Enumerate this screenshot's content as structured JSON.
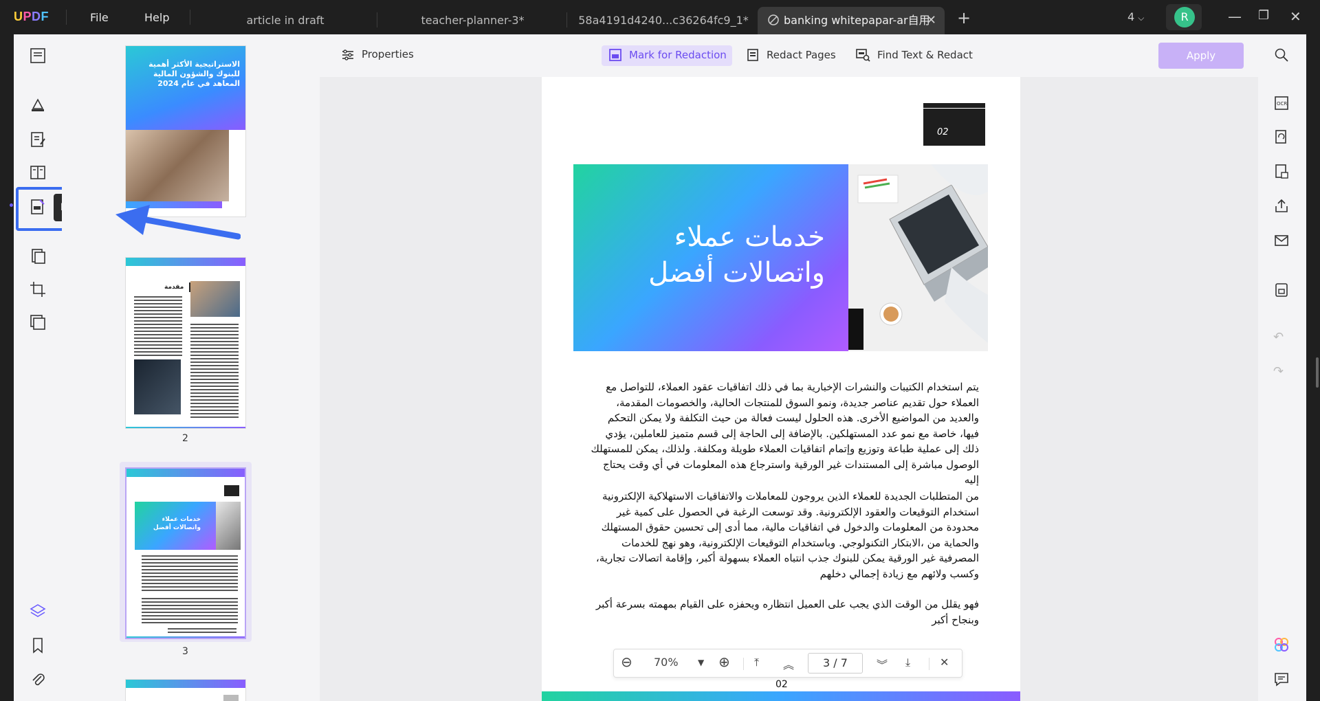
{
  "app": {
    "logo": "UPDF",
    "menu": [
      "File",
      "Help"
    ]
  },
  "tabs": [
    {
      "label": "article in draft"
    },
    {
      "label": "teacher-planner-3*"
    },
    {
      "label": "58a4191d4240...c36264fc9_1*"
    },
    {
      "label": "banking whitepapar-ar自用",
      "active": true
    }
  ],
  "window": {
    "tab_count": "4",
    "avatar_initial": "R"
  },
  "left_rail": {
    "tooltip": "Redact",
    "icons": [
      "reader-icon",
      "comment-icon",
      "edit-pdf-icon",
      "organize-icon",
      "redact-icon",
      "page-tools-icon",
      "crop-icon",
      "batch-icon",
      "layers-icon",
      "bookmark-icon",
      "attachment-icon"
    ]
  },
  "thumbnails": [
    {
      "page": "",
      "title": "الاستراتيجية الأكثر أهمية للبنوك والشؤون المالية المعاهد في عام 2024"
    },
    {
      "page": "2",
      "title": "مقدمة"
    },
    {
      "page": "3",
      "title": "خدمات عملاء واتصالات أفضل",
      "selected": true
    },
    {
      "page": ""
    }
  ],
  "toolbar": {
    "properties": "Properties",
    "mark_for_redaction": "Mark for Redaction",
    "redact_pages": "Redact Pages",
    "find_text_redact": "Find Text & Redact",
    "apply": "Apply"
  },
  "page": {
    "number_box": "02",
    "banner_title_line1": "خدمات عملاء",
    "banner_title_line2": "واتصالات أفضل",
    "paragraph1": "يتم استخدام الكتيبات والنشرات الإخبارية بما في ذلك اتفاقيات عقود العملاء، للتواصل مع العملاء حول تقديم عناصر جديدة، ونمو السوق للمنتجات الحالية، والخصومات المقدمة، والعديد من المواضيع الأخرى. هذه الحلول ليست فعالة من حيث التكلفة ولا يمكن التحكم فيها، خاصة مع نمو عدد المستهلكين. بالإضافة إلى الحاجة إلى قسم متميز للعاملين، يؤدي ذلك إلى عملية طباعة وتوزيع وإتمام اتفاقيات العملاء طويلة ومكلفة. ولذلك، يمكن للمستهلك الوصول مباشرة إلى المستندات غير الورقية واسترجاع هذه المعلومات في أي وقت يحتاج إليه",
    "paragraph2": "من المتطلبات الجديدة للعملاء الذين يروجون للمعاملات والاتفاقيات الاستهلاكية الإلكترونية استخدام التوقيعات والعقود الإلكترونية. وقد توسعت الرغبة في الحصول على كمية غير محدودة من المعلومات والدخول في اتفاقيات مالية، مما أدى إلى تحسين حقوق المستهلك والحماية من ،الابتكار التكنولوجي. وباستخدام التوقيعات الإلكترونية، وهو نهج للخدمات المصرفية غير الورقية يمكن للبنوك جذب انتباه العملاء بسهولة أكبر، وإقامة اتصالات تجارية، وكسب ولائهم مع زيادة إجمالي دخلهم",
    "paragraph3": "فهو يقلل من الوقت الذي يجب على العميل انتظاره ويحفزه على القيام بمهمته بسرعة أكبر وبنجاح أكبر",
    "footer_number": "02"
  },
  "zoom": {
    "level": "70%",
    "current_page": "3",
    "separator": "/",
    "total_pages": "7"
  },
  "right_rail": {
    "icons": [
      "search-icon",
      "ocr-icon",
      "convert-icon",
      "protect-icon",
      "share-icon",
      "email-icon",
      "save-icon",
      "undo-icon",
      "redo-icon",
      "ai-assistant-icon",
      "chat-icon"
    ]
  },
  "colors": {
    "accent": "#8a5cff",
    "apply_bg": "#c8b1f7",
    "highlight_blue": "#3b6df0",
    "avatar": "#36c28a"
  }
}
